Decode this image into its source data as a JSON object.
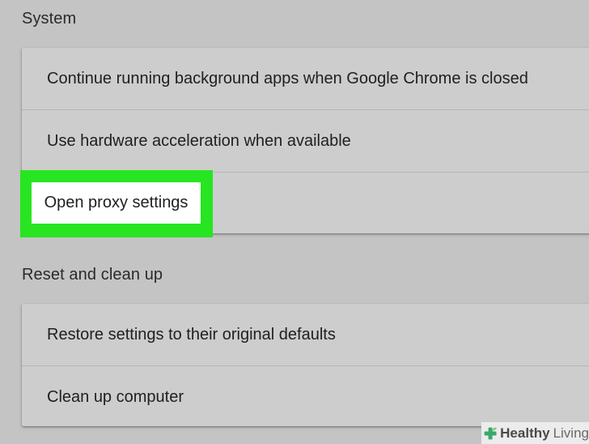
{
  "system": {
    "title": "System",
    "items": [
      {
        "label": "Continue running background apps when Google Chrome is closed"
      },
      {
        "label": "Use hardware acceleration when available"
      },
      {
        "label": "Open proxy settings"
      }
    ]
  },
  "reset": {
    "title": "Reset and clean up",
    "items": [
      {
        "label": "Restore settings to their original defaults"
      },
      {
        "label": "Clean up computer"
      }
    ]
  },
  "watermark": {
    "brand_bold": "Healthy",
    "brand_light": "Living"
  },
  "colors": {
    "highlight": "#27e521",
    "background": "#c4c4c4",
    "card": "#cdcdcd"
  }
}
